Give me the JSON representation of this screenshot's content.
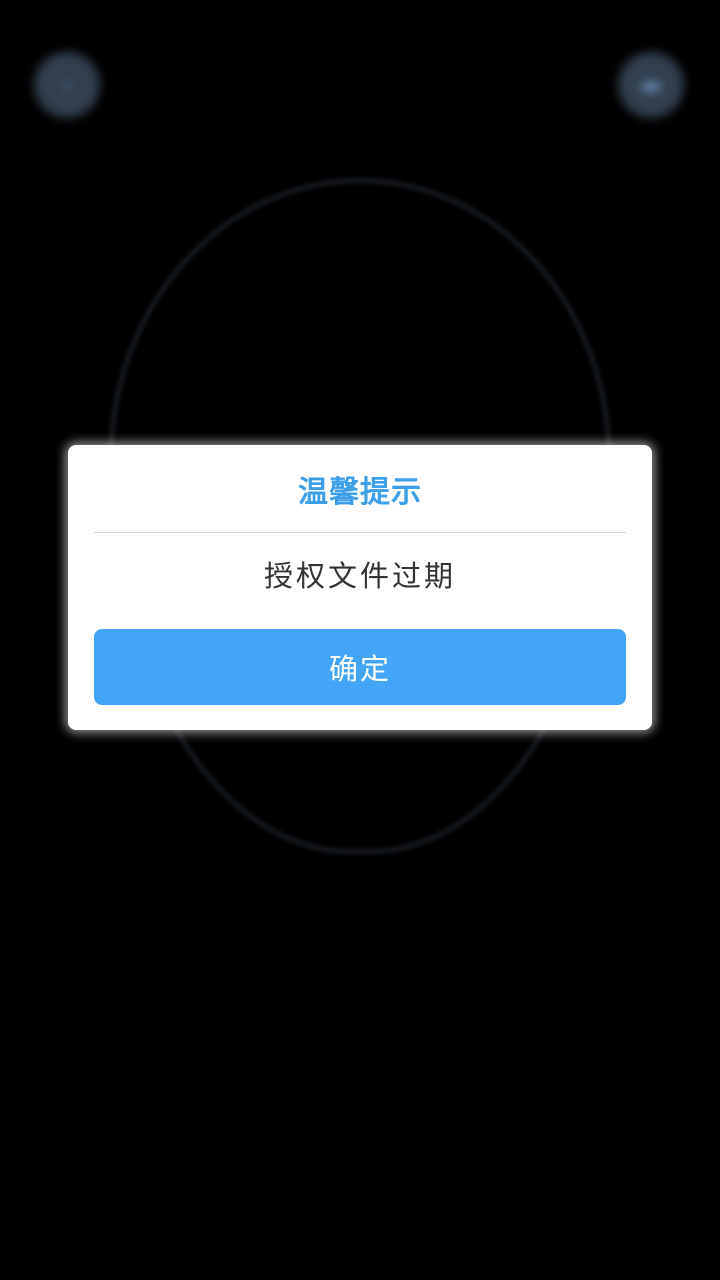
{
  "background": {
    "left_button_icon": "back-icon",
    "right_button_icon": "switch-camera-icon",
    "overlay_shape": "face-outline"
  },
  "dialog": {
    "title": "温馨提示",
    "message": "授权文件过期",
    "confirm_label": "确定"
  },
  "colors": {
    "accent": "#3c9fe8",
    "button": "#42a5f5",
    "message_text": "#333333",
    "background": "#000000"
  }
}
